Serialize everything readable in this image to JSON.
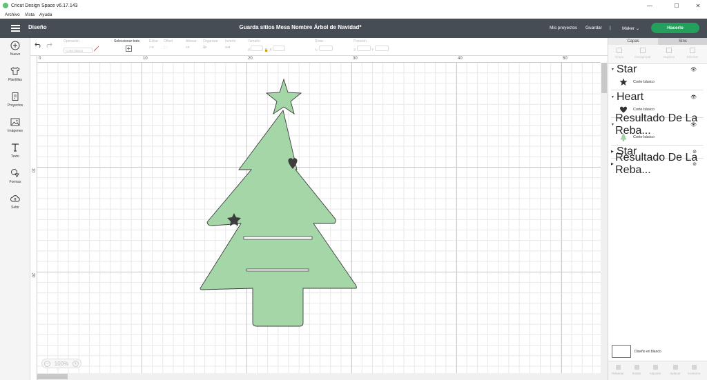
{
  "window": {
    "title": "Cricut Design Space  v6.17.143",
    "minimize": "—",
    "maximize": "☐",
    "close": "✕"
  },
  "menu": [
    "Archivo",
    "Vista",
    "Ayuda"
  ],
  "appbar": {
    "section": "Diseño",
    "document_title": "Guarda sitios Mesa Nombre Árbol de Navidad*",
    "my_projects": "Mis proyectos",
    "save": "Guardar",
    "separator": "|",
    "machine": "Maker",
    "make_it": "Hacerlo"
  },
  "sidebar": [
    {
      "label": "Nuevo",
      "icon": "plus-circle-icon"
    },
    {
      "label": "Plantillas",
      "icon": "shirt-icon"
    },
    {
      "label": "Proyectos",
      "icon": "projects-icon"
    },
    {
      "label": "Imágenes",
      "icon": "image-icon"
    },
    {
      "label": "Texto",
      "icon": "text-icon"
    },
    {
      "label": "Formas",
      "icon": "shapes-icon"
    },
    {
      "label": "Subir",
      "icon": "upload-cloud-icon"
    }
  ],
  "toolbar": {
    "operation_label": "Operación",
    "operation_value": "Corte básico",
    "select_all": "Seleccionar todo",
    "edit": "Editar",
    "offset": "Offset",
    "align": "Alinear",
    "organize": "Organizar",
    "flip": "Invertir",
    "size": "Tamaño",
    "size_w": "A",
    "size_h": "A",
    "rotate": "Rotar",
    "position": "Posición",
    "pos_x": "X",
    "pos_y": "Y"
  },
  "ruler": {
    "top": [
      "0",
      "10",
      "20",
      "30",
      "40",
      "50"
    ],
    "left": [
      "10",
      "20"
    ]
  },
  "zoom": {
    "value": "100%",
    "minus": "−",
    "plus": "+"
  },
  "panel": {
    "tabs": [
      "Capas",
      "Sinc"
    ],
    "tools": [
      "Grupo",
      "Desagrupar",
      "Duplicar",
      "Eliminar"
    ],
    "layers": [
      {
        "name": "Star",
        "expanded": true,
        "sub": "Corte básico",
        "icon": "star-icon",
        "visible": true
      },
      {
        "name": "Heart",
        "expanded": true,
        "sub": "Corte básico",
        "icon": "heart-icon",
        "visible": true
      },
      {
        "name": "Resultado De La Reba...",
        "expanded": true,
        "sub": "Corte básico",
        "icon": "tree-icon",
        "visible": true
      },
      {
        "name": "Star",
        "expanded": false,
        "visible": false
      },
      {
        "name": "Resultado De La Reba...",
        "expanded": false,
        "visible": false
      }
    ],
    "blank_canvas": "Diseño en blanco",
    "bottom_tools": [
      "Rebanar",
      "Soldar",
      "Adjuntar",
      "Aplanar",
      "Contorno"
    ]
  },
  "colors": {
    "appbar": "#474d55",
    "accent_green": "#23a05b",
    "tree_fill": "#a5d6a7",
    "dark_shape": "#3d3d3d"
  }
}
